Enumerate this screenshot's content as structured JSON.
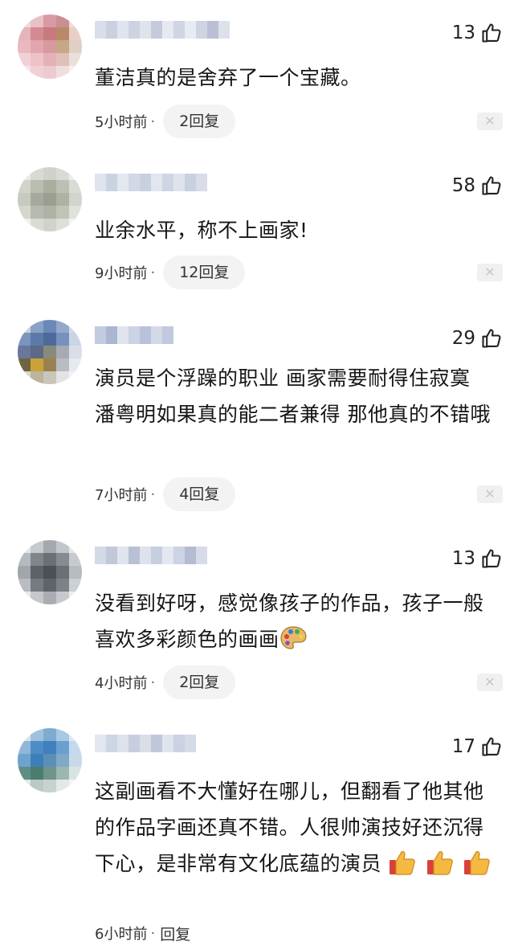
{
  "comments": [
    {
      "likes": "13",
      "text": "董洁真的是舍弃了一个宝藏。",
      "time": "5小时前",
      "dot": "·",
      "replies": "2回复",
      "close": "✕"
    },
    {
      "likes": "58",
      "text": "业余水平，称不上画家!",
      "time": "9小时前",
      "dot": "·",
      "replies": "12回复",
      "close": "✕"
    },
    {
      "likes": "29",
      "text": "演员是个浮躁的职业 画家需要耐得住寂寞 潘粤明如果真的能二者兼得 那他真的不错哦",
      "time": "7小时前",
      "dot": "·",
      "replies": "4回复",
      "close": "✕"
    },
    {
      "likes": "13",
      "text": "没看到好呀，感觉像孩子的作品，孩子一般喜欢多彩颜色的画画",
      "emoji": "artist-palette",
      "time": "4小时前",
      "dot": "·",
      "replies": "2回复",
      "close": "✕"
    },
    {
      "likes": "17",
      "text": "这副画看不大懂好在哪儿，但翻看了他其他的作品字画还真不错。人很帅演技好还沉得下心，是非常有文化底蕴的演员",
      "emoji": "thumbs-up",
      "time": "6小时前",
      "dot": "·",
      "replies": "回复"
    }
  ],
  "colors": {
    "text": "#161616",
    "meta": "#333333",
    "pill": "#f3f3f3",
    "close_bg": "#f0f0f0"
  }
}
